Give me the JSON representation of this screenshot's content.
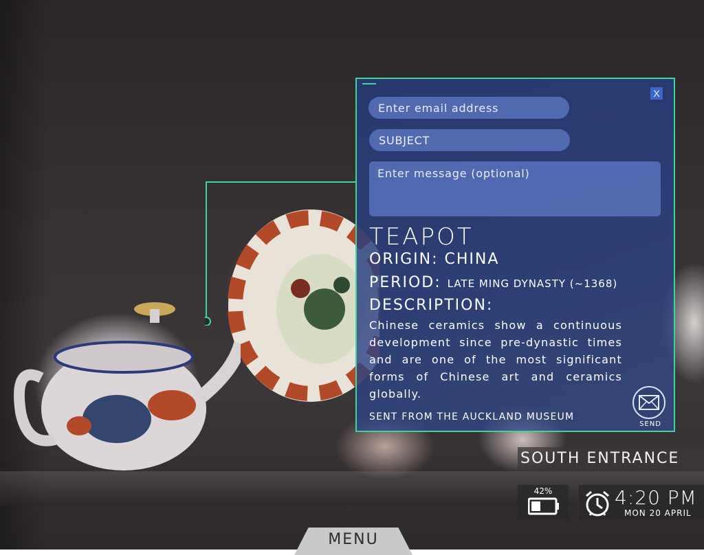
{
  "scene": {
    "accent_color": "#3fd3a0",
    "panel_color": "#2a4082"
  },
  "form": {
    "email_placeholder": "Enter email address",
    "subject_value": "SUBJECT",
    "message_placeholder": "Enter message (optional)",
    "close_label": "X",
    "send_label": "SEND"
  },
  "item": {
    "title": "TEAPOT",
    "origin_label": "ORIGIN:",
    "origin_value": "CHINA",
    "period_label": "PERIOD:",
    "period_value": "LATE MING DYNASTY (~1368)",
    "description_label": "DESCRIPTION:",
    "description": "Chinese ceramics show a continuous development since pre-dynastic times and are one of the most significant forms of Chinese art and ceramics globally.",
    "footer": "SENT FROM THE AUCKLAND MUSEUM"
  },
  "status": {
    "location": "SOUTH ENTRANCE",
    "battery_percent": "42%",
    "battery_level": 0.42,
    "time": "4:20 PM",
    "date": "MON 20 APRIL"
  },
  "nav": {
    "menu_label": "MENU"
  },
  "icons": {
    "close": "close-icon",
    "send": "envelope-icon",
    "battery": "battery-icon",
    "clock": "alarm-clock-icon"
  }
}
